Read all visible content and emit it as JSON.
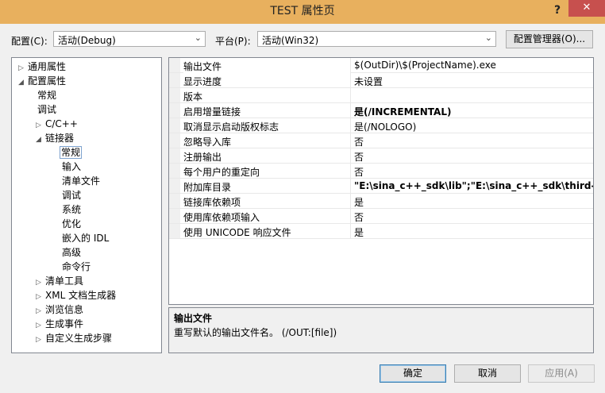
{
  "window": {
    "title": "TEST 属性页",
    "help_glyph": "?",
    "close_glyph": "✕"
  },
  "config": {
    "label": "配置(C):",
    "value": "活动(Debug)"
  },
  "platform": {
    "label": "平台(P):",
    "value": "活动(Win32)"
  },
  "config_manager_label": "配置管理器(O)...",
  "tree": [
    {
      "label": "通用属性",
      "arrow": "▷"
    },
    {
      "label": "配置属性",
      "arrow": "◢"
    },
    {
      "label": "常规",
      "arrow": ""
    },
    {
      "label": "调试",
      "arrow": ""
    },
    {
      "label": "C/C++",
      "arrow": "▷"
    },
    {
      "label": "链接器",
      "arrow": "◢"
    },
    {
      "label": "常规",
      "arrow": ""
    },
    {
      "label": "输入",
      "arrow": ""
    },
    {
      "label": "清单文件",
      "arrow": ""
    },
    {
      "label": "调试",
      "arrow": ""
    },
    {
      "label": "系统",
      "arrow": ""
    },
    {
      "label": "优化",
      "arrow": ""
    },
    {
      "label": "嵌入的 IDL",
      "arrow": ""
    },
    {
      "label": "高级",
      "arrow": ""
    },
    {
      "label": "命令行",
      "arrow": ""
    },
    {
      "label": "清单工具",
      "arrow": "▷"
    },
    {
      "label": "XML 文档生成器",
      "arrow": "▷"
    },
    {
      "label": "浏览信息",
      "arrow": "▷"
    },
    {
      "label": "生成事件",
      "arrow": "▷"
    },
    {
      "label": "自定义生成步骤",
      "arrow": "▷"
    }
  ],
  "properties": [
    {
      "name": "输出文件",
      "value": "$(OutDir)\\$(ProjectName).exe"
    },
    {
      "name": "显示进度",
      "value": "未设置"
    },
    {
      "name": "版本",
      "value": ""
    },
    {
      "name": "启用增量链接",
      "value": "是(/INCREMENTAL)"
    },
    {
      "name": "取消显示启动版权标志",
      "value": "是(/NOLOGO)"
    },
    {
      "name": "忽略导入库",
      "value": "否"
    },
    {
      "name": "注册输出",
      "value": "否"
    },
    {
      "name": "每个用户的重定向",
      "value": "否"
    },
    {
      "name": "附加库目录",
      "value": "\"E:\\sina_c++_sdk\\lib\";\"E:\\sina_c++_sdk\\third-part"
    },
    {
      "name": "链接库依赖项",
      "value": "是"
    },
    {
      "name": "使用库依赖项输入",
      "value": "否"
    },
    {
      "name": "使用 UNICODE 响应文件",
      "value": "是"
    }
  ],
  "description": {
    "title": "输出文件",
    "text": "重写默认的输出文件名。    (/OUT:[file])"
  },
  "buttons": {
    "ok": "确定",
    "cancel": "取消",
    "apply": "应用(A)"
  }
}
